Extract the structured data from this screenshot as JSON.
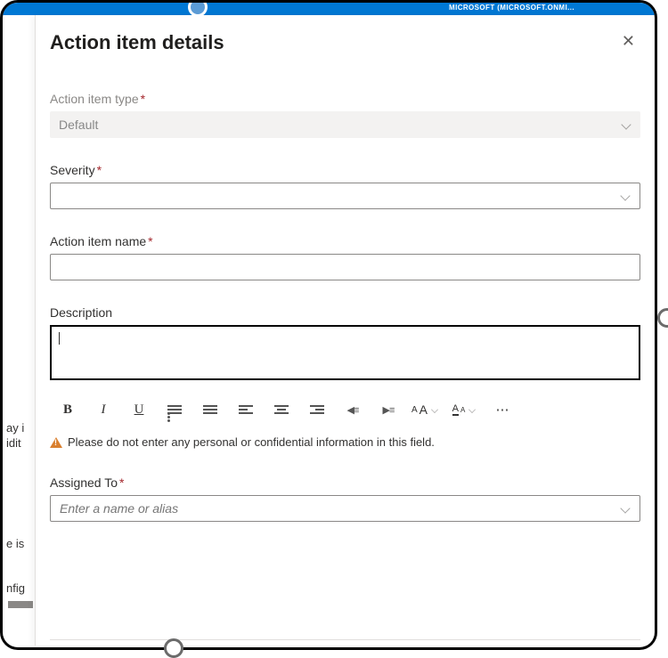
{
  "banner": {
    "text": "MICROSOFT (MICROSOFT.ONMI..."
  },
  "bg_fragments": {
    "a": "ay i",
    "b": "idit",
    "c": "e is",
    "d": "nfig"
  },
  "panel": {
    "title": "Action item details",
    "fields": {
      "type": {
        "label": "Action item type",
        "required": true,
        "value": "Default"
      },
      "severity": {
        "label": "Severity",
        "required": true,
        "value": ""
      },
      "name": {
        "label": "Action item name",
        "required": true,
        "value": ""
      },
      "description": {
        "label": "Description",
        "required": false,
        "value": ""
      },
      "assigned_to": {
        "label": "Assigned To",
        "required": true,
        "placeholder": "Enter a name or alias",
        "value": ""
      }
    },
    "warning": "Please do not enter any personal or confidential information in this field.",
    "rte": {
      "bold": "B",
      "italic": "I",
      "underline": "U",
      "font_size": "AA",
      "font_color": "A",
      "more": "⋯"
    }
  }
}
